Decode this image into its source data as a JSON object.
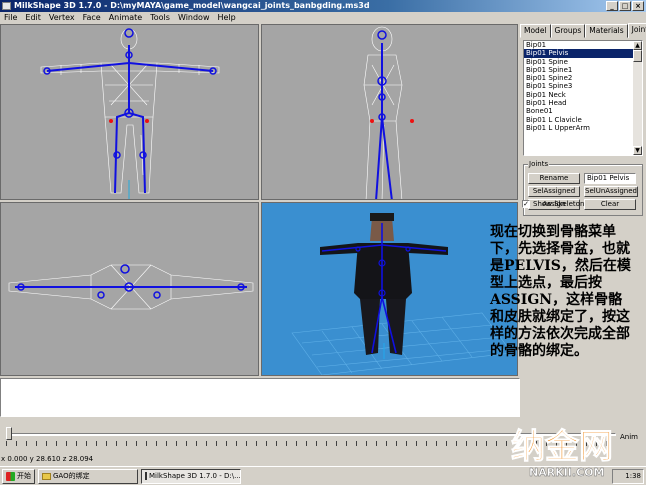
{
  "window": {
    "title": "MilkShape 3D 1.7.0 - D:\\myMAYA\\game_model\\wangcai_joints_banbgding.ms3d"
  },
  "menu": [
    "File",
    "Edit",
    "Vertex",
    "Face",
    "Animate",
    "Tools",
    "Window",
    "Help"
  ],
  "panel": {
    "tabs": [
      "Model",
      "Groups",
      "Materials",
      "Joints"
    ],
    "active_tab": "Joints",
    "joints": [
      "Bip01",
      "Bip01 Pelvis",
      "Bip01 Spine",
      "Bip01 Spine1",
      "Bip01 Spine2",
      "Bip01 Spine3",
      "Bip01 Neck",
      "Bip01 Head",
      "Bone01",
      "Bip01 L Clavicle",
      "Bip01 L UpperArm"
    ],
    "selected_joint": "Bip01 Pelvis",
    "group_title": "Joints",
    "rename_label": "Rename",
    "name_value": "Bip01 Pelvis",
    "sel_assigned_label": "SelAssigned",
    "sel_unassigned_label": "SelUnAssigned",
    "assign_label": "Assign",
    "clear_label": "Clear",
    "show_skeleton_label": "Show Skeleton",
    "show_skeleton_checked": true
  },
  "annotation": "现在切换到骨骼菜单下，先选择骨盆，也就是PELVIS，然后在模型上选点，最后按ASSIGN，这样骨骼和皮肤就绑定了，按这样的方法依次完成全部的骨骼的绑定。",
  "timeline": {
    "anim_label": "Anim"
  },
  "status": {
    "coords": "x 0.000 y 28.610 z 28.094"
  },
  "taskbar": {
    "start_label": "开始",
    "items": [
      "GAO的绑定",
      "MilkShape 3D 1.7.0 - D:\\..."
    ],
    "clock": "1:38"
  },
  "watermark": {
    "text": "纳金网",
    "url": "NARKII.COM"
  },
  "colors": {
    "viewport_bg": "#a5a5a5",
    "view3d_bg": "#3a8fd0",
    "skeleton": "#1010e0",
    "titlebar": "#0a246a"
  }
}
